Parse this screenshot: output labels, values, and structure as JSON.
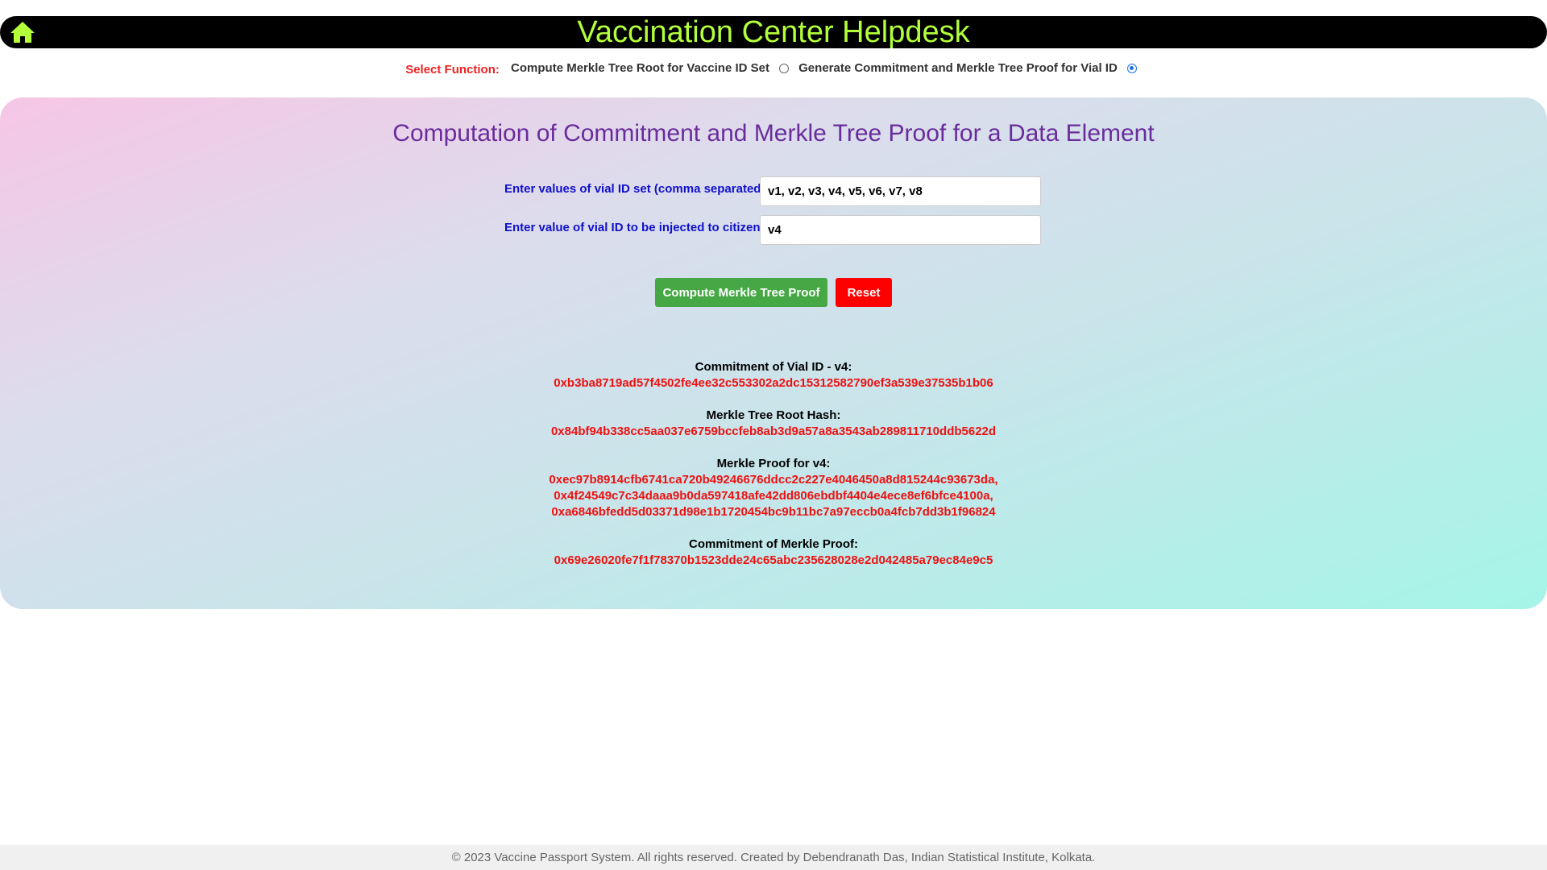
{
  "header": {
    "title": "Vaccination Center Helpdesk",
    "title_color": "#b3ff3a"
  },
  "selector": {
    "label": "Select Function:",
    "options": [
      {
        "label": "Compute Merkle Tree Root for Vaccine ID Set",
        "checked": false
      },
      {
        "label": "Generate Commitment and Merkle Tree Proof for Vial ID",
        "checked": true
      }
    ]
  },
  "panel": {
    "title": "Computation of Commitment and Merkle Tree Proof for a Data Element",
    "fields": {
      "vial_set_label": "Enter values of vial ID set (comma separated):",
      "vial_set_value": "v1, v2, v3, v4, v5, v6, v7, v8",
      "vial_id_label": "Enter value of vial ID to be injected to citizen:",
      "vial_id_value": "v4"
    },
    "buttons": {
      "compute": "Compute Merkle Tree Proof",
      "reset": "Reset"
    }
  },
  "results": {
    "commitment_label": "Commitment of Vial ID - v4:",
    "commitment_value": "0xb3ba8719ad57f4502fe4ee32c553302a2dc15312582790ef3a539e37535b1b06",
    "root_label": "Merkle Tree Root Hash:",
    "root_value": "0x84bf94b338cc5aa037e6759bccfeb8ab3d9a57a8a3543ab289811710ddb5622d",
    "proof_label": "Merkle Proof for v4:",
    "proof_values": [
      "0xec97b8914cfb6741ca720b49246676ddcc2c227e4046450a8d815244c93673da,",
      "0x4f24549c7c34daaa9b0da597418afe42dd806ebdbf4404e4ece8ef6bfce4100a,",
      "0xa6846bfedd5d03371d98e1b1720454bc9b11bc7a97eccb0a4fcb7dd3b1f96824"
    ],
    "proof_commitment_label": "Commitment of Merkle Proof:",
    "proof_commitment_value": "0x69e26020fe7f1f78370b1523dde24c65abc235628028e2d042485a79ec84e9c5"
  },
  "footer": {
    "text": "© 2023 Vaccine Passport System. All rights reserved. Created by Debendranath Das, Indian Statistical Institute, Kolkata."
  }
}
